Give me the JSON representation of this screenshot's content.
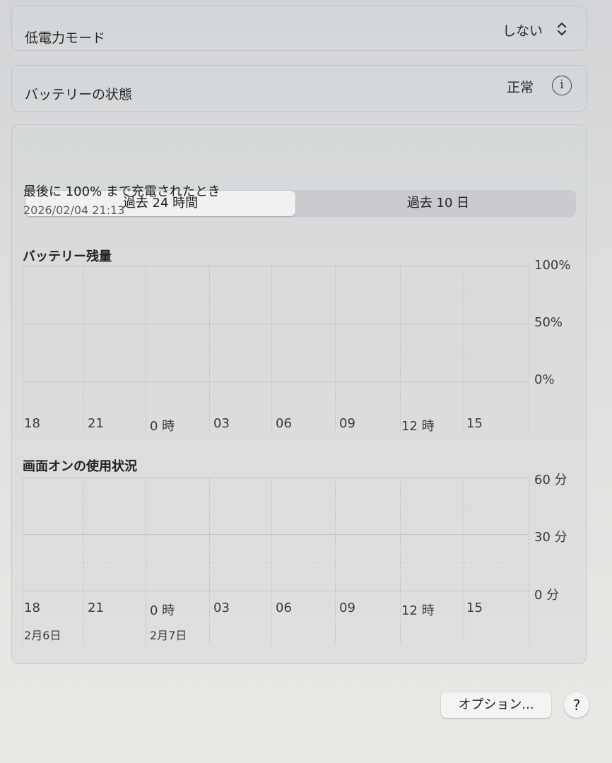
{
  "low_power": {
    "label": "低電力モード",
    "value": "しない"
  },
  "battery_health": {
    "label": "バッテリーの状態",
    "value": "正常",
    "info_icon": "i"
  },
  "tabs": [
    {
      "label": "過去 24 時間",
      "selected": true
    },
    {
      "label": "過去 10 日",
      "selected": false
    }
  ],
  "last_charge": {
    "title": "最後に 100% まで充電されたとき",
    "timestamp": "2026/02/04 21:13"
  },
  "battery_level_chart": {
    "title": "バッテリー残量",
    "y_labels": [
      "100%",
      "50%",
      "0%"
    ],
    "x_labels": [
      "18",
      "21",
      "0 時",
      "03",
      "06",
      "09",
      "12 時",
      "15"
    ]
  },
  "screen_usage_chart": {
    "title": "画面オンの使用状況",
    "y_labels": [
      "60 分",
      "30 分",
      "0 分"
    ],
    "x_labels": [
      "18",
      "21",
      "0 時",
      "03",
      "06",
      "09",
      "12 時",
      "15"
    ],
    "date_labels": [
      "2月6日",
      "2月7日"
    ]
  },
  "chart_data": [
    {
      "type": "line",
      "title": "バッテリー残量",
      "x": [
        "18",
        "21",
        "0 時",
        "03",
        "06",
        "09",
        "12 時",
        "15"
      ],
      "ylim": [
        0,
        100
      ],
      "y_ticks": [
        "100%",
        "50%",
        "0%"
      ],
      "series": []
    },
    {
      "type": "bar",
      "title": "画面オンの使用状況",
      "categories": [
        "18",
        "21",
        "0 時",
        "03",
        "06",
        "09",
        "12 時",
        "15"
      ],
      "ylim": [
        0,
        60
      ],
      "y_ticks": [
        "60 分",
        "30 分",
        "0 分"
      ],
      "series": []
    }
  ],
  "footer": {
    "options_label": "オプション...",
    "help_label": "?"
  }
}
